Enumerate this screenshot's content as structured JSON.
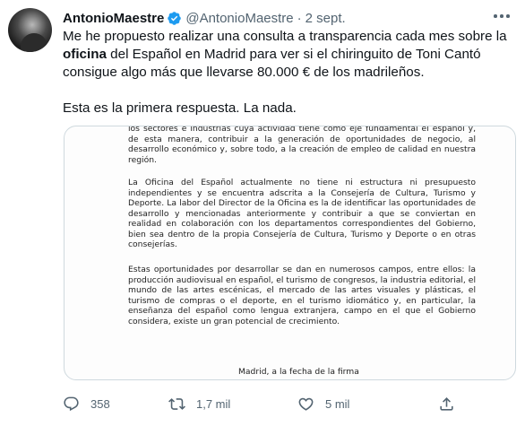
{
  "tweet": {
    "author_name": "AntonioMaestre",
    "author_handle": "@AntonioMaestre",
    "separator": "·",
    "date": "2 sept.",
    "text_p1_before": "Me he propuesto realizar una consulta a transparencia cada mes sobre la ",
    "text_p1_bold": "oficina",
    "text_p1_after": " del Español en Madrid para ver si el chiringuito de Toni Cantó consigue algo más que llevarse 80.000 € de los madrileños.",
    "text_p2": "Esta es la primera respuesta. La nada."
  },
  "document": {
    "para_top": "los sectores e industrias cuya actividad tiene como eje fundamental el español y, de esta manera, contribuir a la generación de oportunidades de negocio, al desarrollo económico y, sobre todo, a la creación de empleo de calidad en nuestra región.",
    "para_middle": "La Oficina del Español actualmente no tiene ni estructura ni presupuesto independientes y se encuentra adscrita a la Consejería de Cultura, Turismo y Deporte. La labor del Director de la Oficina es la de identificar las oportunidades de desarrollo y mencionadas anteriormente y contribuir a que se conviertan en realidad en colaboración con los departamentos correspondientes del Gobierno, bien sea dentro de la propia Consejería de Cultura, Turismo y Deporte o en otras consejerías.",
    "para_bottom": "Estas oportunidades por desarrollar se dan en numerosos campos, entre ellos: la producción audiovisual en español, el turismo de congresos, la industria editorial, el mundo de las artes escénicas, el mercado de las artes visuales y plásticas, el turismo de compras o el deporte, en el turismo idiomático y, en particular, la enseñanza del español como lengua extranjera, campo en el que el Gobierno considera, existe un gran potencial de crecimiento.",
    "signature_line": "Madrid, a la fecha de la firma"
  },
  "actions": {
    "reply_count": "358",
    "retweet_count": "1,7 mil",
    "like_count": "5 mil"
  },
  "icons": {
    "verified": "verified-badge-icon",
    "more": "more-options-icon",
    "reply": "reply-icon",
    "retweet": "retweet-icon",
    "like": "heart-icon",
    "share": "share-icon"
  },
  "colors": {
    "verified_blue": "#1d9bf0",
    "secondary_text": "#536471",
    "border": "#cfd9de"
  }
}
